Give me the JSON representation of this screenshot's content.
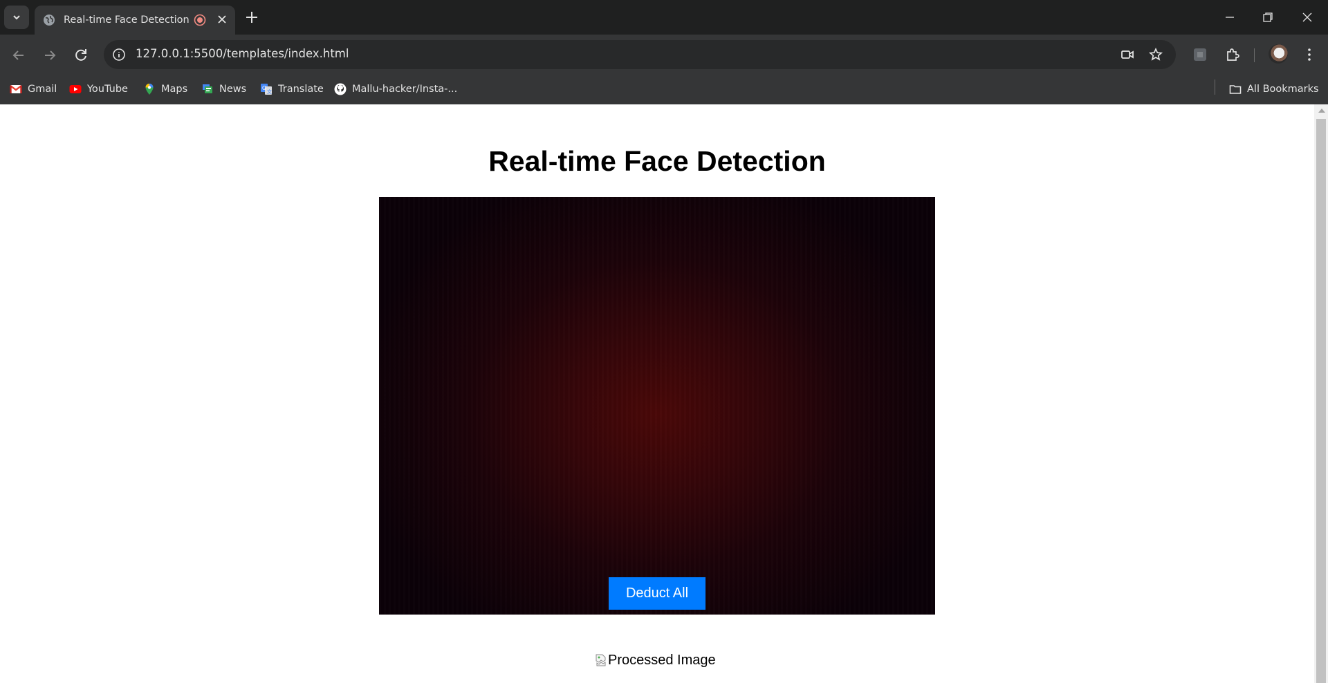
{
  "browser": {
    "tab_title": "Real-time Face Detection",
    "url": "127.0.0.1:5500/templates/index.html",
    "bookmarks": [
      {
        "label": "Gmail",
        "icon": "gmail-icon"
      },
      {
        "label": "YouTube",
        "icon": "youtube-icon"
      },
      {
        "label": "Maps",
        "icon": "maps-icon"
      },
      {
        "label": "News",
        "icon": "news-icon"
      },
      {
        "label": "Translate",
        "icon": "translate-icon"
      },
      {
        "label": "Mallu-hacker/Insta-...",
        "icon": "github-icon"
      }
    ],
    "all_bookmarks_label": "All Bookmarks"
  },
  "page": {
    "heading": "Real-time Face Detection",
    "deduct_button_label": "Deduct All",
    "processed_image_alt": "Processed Image"
  },
  "colors": {
    "button_blue": "#007bff",
    "chrome_dark": "#1f2020",
    "chrome_toolbar": "#353637"
  }
}
